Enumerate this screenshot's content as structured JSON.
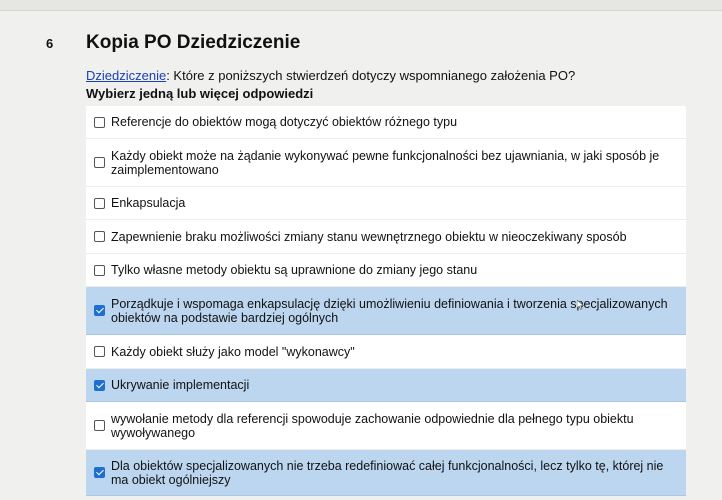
{
  "question": {
    "number": "6",
    "title": "Kopia PO Dziedziczenie",
    "prompt_link": "Dziedziczenie",
    "prompt_text": ": Które z poniższych stwierdzeń dotyczy wspomnianego założenia PO?",
    "instruction": "Wybierz jedną lub więcej odpowiedzi"
  },
  "options": [
    {
      "label": "Referencje do obiektów mogą dotyczyć obiektów różnego typu",
      "checked": false
    },
    {
      "label": "Każdy obiekt może na żądanie wykonywać pewne funkcjonalności bez ujawniania, w jaki sposób je zaimplementowano",
      "checked": false
    },
    {
      "label": "Enkapsulacja",
      "checked": false
    },
    {
      "label": "Zapewnienie braku możliwości zmiany stanu wewnętrznego obiektu w nieoczekiwany sposób",
      "checked": false
    },
    {
      "label": "Tylko własne metody obiektu są uprawnione do zmiany jego stanu",
      "checked": false
    },
    {
      "label": "Porządkuje i wspomaga enkapsulację dzięki umożliwieniu definiowania i tworzenia specjalizowanych obiektów na podstawie bardziej ogólnych",
      "checked": true
    },
    {
      "label": "Każdy obiekt służy jako model \"wykonawcy\"",
      "checked": false
    },
    {
      "label": "Ukrywanie implementacji",
      "checked": true
    },
    {
      "label": "wywołanie metody dla referencji spowoduje zachowanie odpowiednie dla pełnego typu obiektu wywoływanego",
      "checked": false
    },
    {
      "label": "Dla obiektów specjalizowanych nie trzeba redefiniować całej funkcjonalności, lecz tylko tę, której nie ma obiekt ogólniejszy",
      "checked": true
    }
  ]
}
